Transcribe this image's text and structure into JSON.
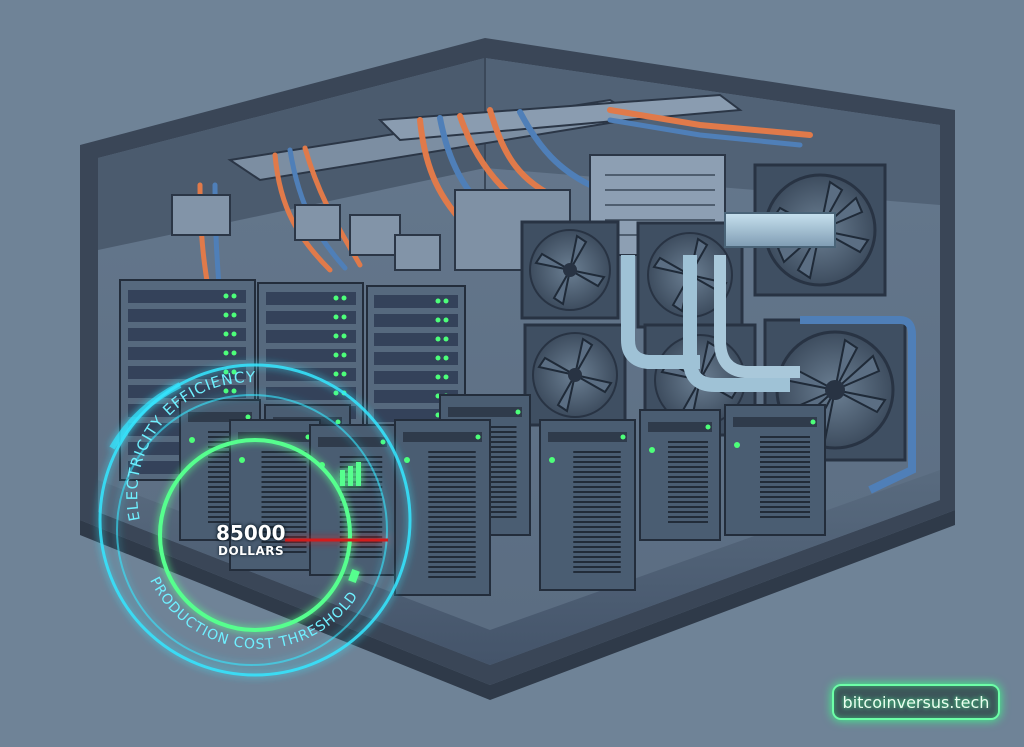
{
  "gauge": {
    "arc_label_top": "ELECTRICITY EFFICIENCY",
    "arc_label_bottom": "PRODUCTION COST THRESHOLD",
    "value": "85000",
    "unit": "DOLLARS"
  },
  "watermark": {
    "text": "bitcoinversus.tech"
  },
  "palette": {
    "background": "#6f8397",
    "room_frame": "#3a4657",
    "room_wall": "#56687d",
    "floor": "#4d5e71",
    "rack": "#4a5d72",
    "rack_dark": "#2f3b4b",
    "led_green": "#4dff7a",
    "pipe_orange": "#e07a4a",
    "pipe_blue": "#4f7fb8",
    "duct": "#9fb9cc",
    "hud_cyan": "#35e6ff",
    "hud_green": "#56ff8e",
    "threshold_red": "#d21f1f"
  }
}
